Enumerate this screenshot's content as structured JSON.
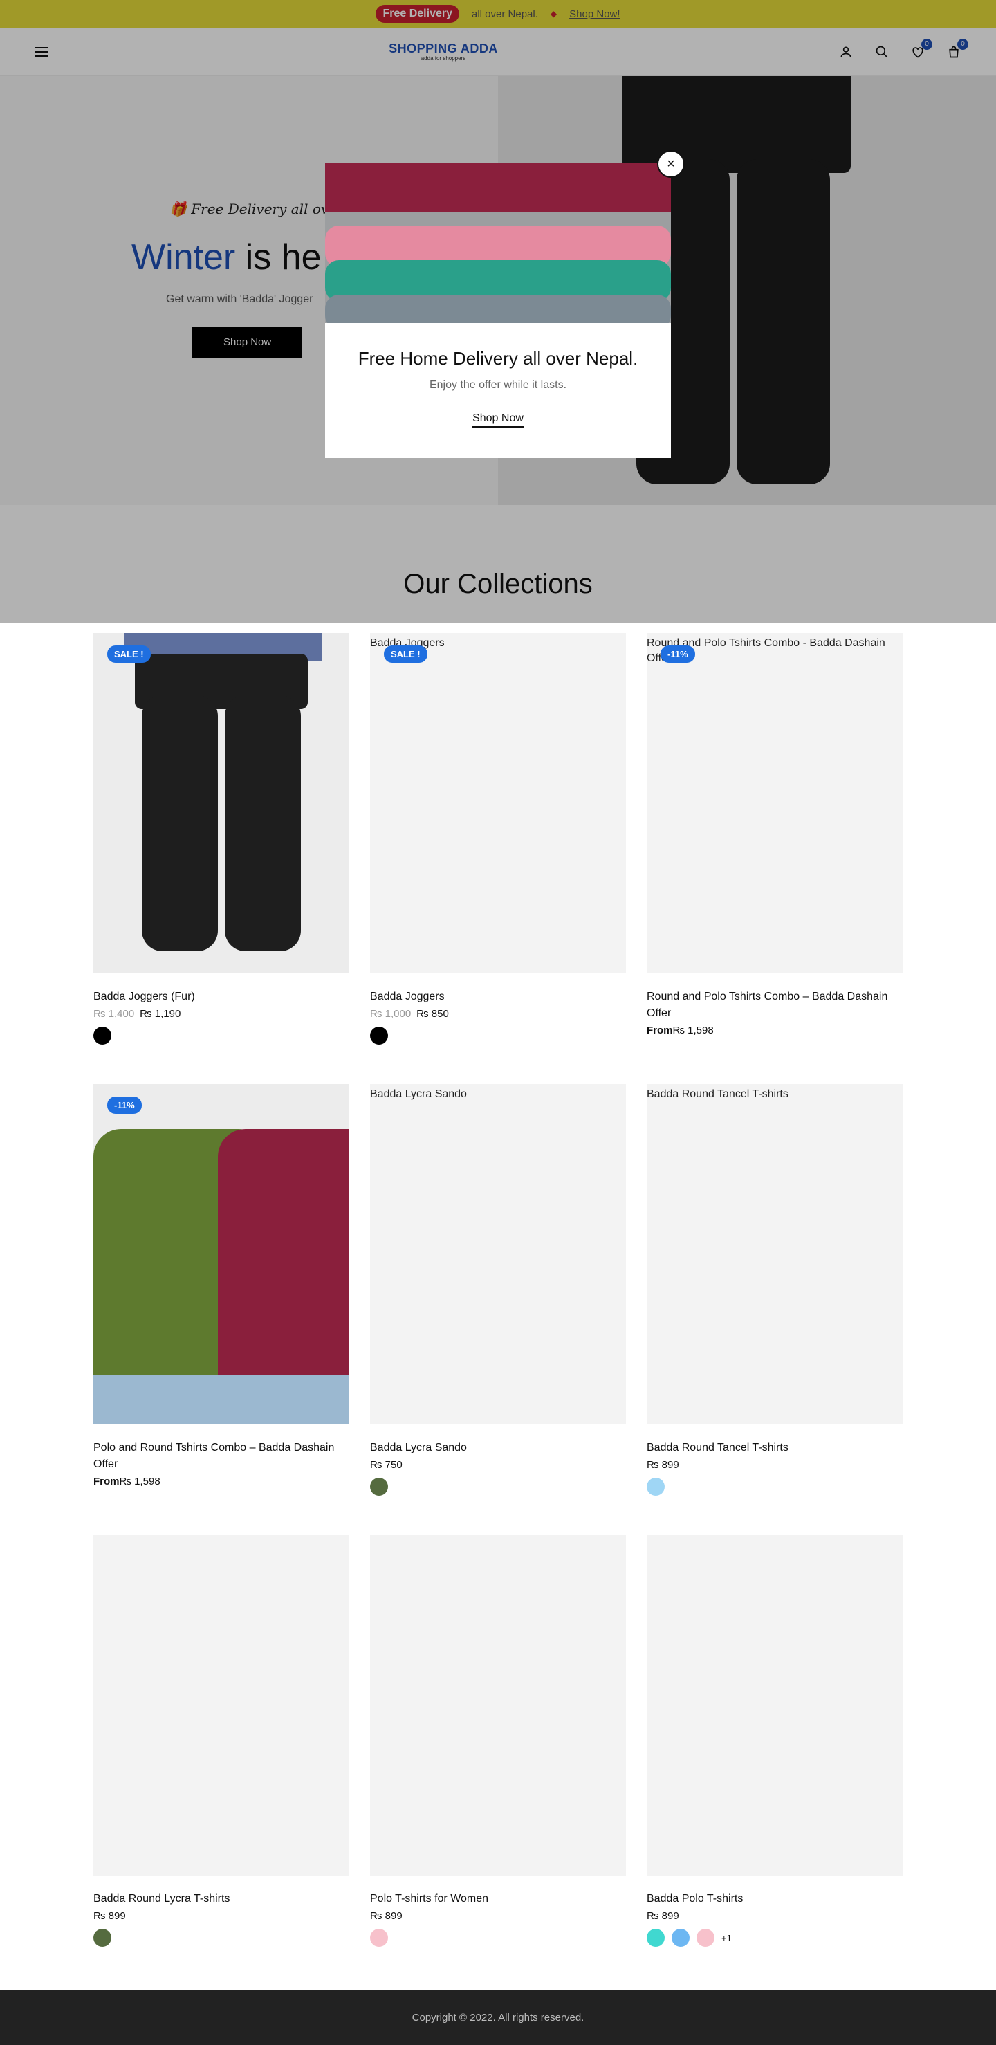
{
  "topbar": {
    "badge": "Free Delivery",
    "text": "all over Nepal.",
    "link": "Shop Now!"
  },
  "header": {
    "logo": "SHOPPING ADDA",
    "logo_sub": "adda for shoppers",
    "wishlist_count": "0",
    "cart_count": "0"
  },
  "hero": {
    "tag": "Free Delivery all over NEPAL",
    "title_blue": "Winter",
    "title_rest": " is he",
    "desc": "Get warm with 'Badda' Jogger",
    "button": "Shop Now"
  },
  "section": {
    "title": "Our Collections"
  },
  "products": [
    {
      "name": "Badda Joggers (Fur)",
      "badge": "SALE !",
      "old": "₨ 1,400",
      "price": "₨ 1,190",
      "from": "",
      "alt": "",
      "swatches": [
        "#000000"
      ],
      "more": ""
    },
    {
      "name": "Badda Joggers",
      "badge": "SALE !",
      "old": "₨ 1,000",
      "price": "₨ 850",
      "from": "",
      "alt": "Badda Joggers",
      "swatches": [
        "#000000"
      ],
      "more": ""
    },
    {
      "name": "Round and Polo Tshirts Combo – Badda Dashain Offer",
      "badge": "-11%",
      "old": "",
      "price": "₨ 1,598",
      "from": "From",
      "alt": "Round and Polo Tshirts Combo - Badda Dashain Offer",
      "swatches": [],
      "more": ""
    },
    {
      "name": "Polo and Round Tshirts Combo – Badda Dashain Offer",
      "badge": "-11%",
      "old": "",
      "price": "₨ 1,598",
      "from": "From",
      "alt": "",
      "swatches": [],
      "more": ""
    },
    {
      "name": "Badda Lycra Sando",
      "badge": "",
      "old": "",
      "price": "₨ 750",
      "from": "",
      "alt": "Badda Lycra Sando",
      "swatches": [
        "#556b3f"
      ],
      "more": ""
    },
    {
      "name": "Badda Round Tancel T-shirts",
      "badge": "",
      "old": "",
      "price": "₨ 899",
      "from": "",
      "alt": "Badda Round Tancel T-shirts",
      "swatches": [
        "#9fd6f5"
      ],
      "more": ""
    },
    {
      "name": "Badda Round Lycra T-shirts",
      "badge": "",
      "old": "",
      "price": "₨ 899",
      "from": "",
      "alt": "",
      "swatches": [
        "#556b3f"
      ],
      "more": ""
    },
    {
      "name": "Polo T-shirts for Women",
      "badge": "",
      "old": "",
      "price": "₨ 899",
      "from": "",
      "alt": "",
      "swatches": [
        "#f7c1cb"
      ],
      "more": ""
    },
    {
      "name": "Badda Polo T-shirts",
      "badge": "",
      "old": "",
      "price": "₨ 899",
      "from": "",
      "alt": "",
      "swatches": [
        "#40d8d0",
        "#6db7f2",
        "#f7c1cb"
      ],
      "more": "+1"
    }
  ],
  "modal": {
    "title": "Free Home Delivery all over Nepal.",
    "desc": "Enjoy the offer while it lasts.",
    "link": "Shop Now",
    "close": "×"
  },
  "footer": {
    "text": "Copyright © 2022. All rights reserved."
  }
}
